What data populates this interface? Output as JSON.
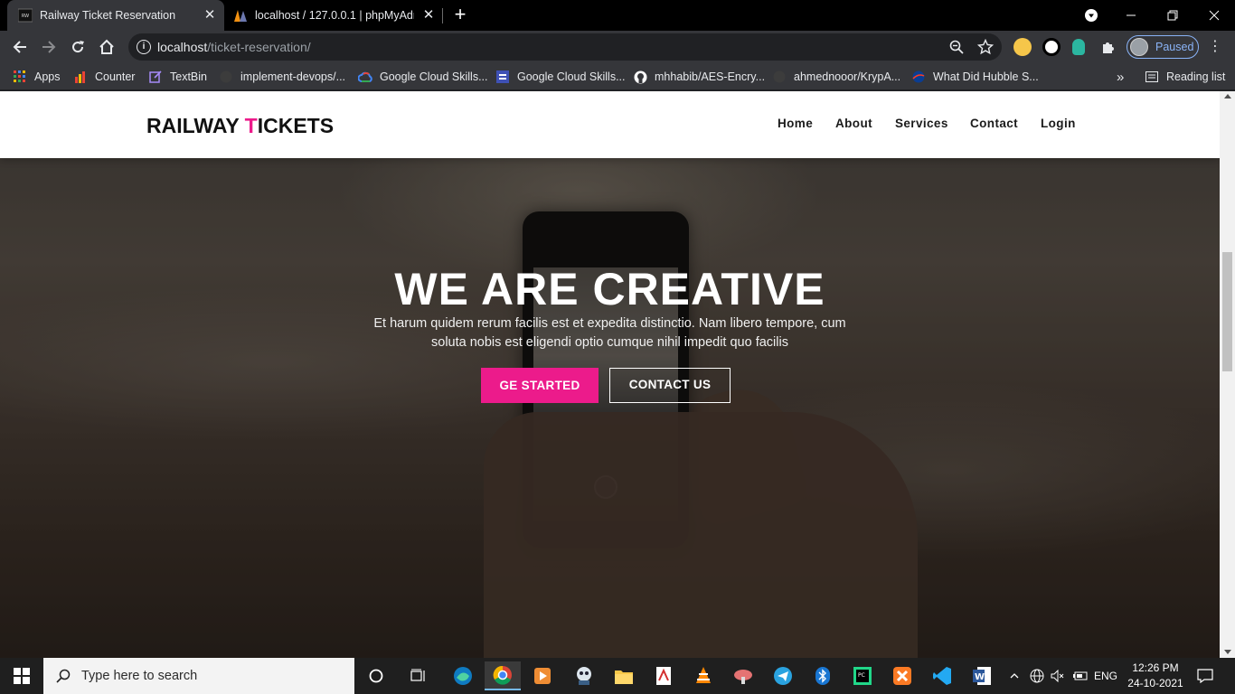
{
  "browser": {
    "tabs": [
      {
        "title": "Railway Ticket Reservation",
        "active": true
      },
      {
        "title": "localhost / 127.0.0.1 | phpMyAdm",
        "active": false
      }
    ],
    "url_host": "localhost",
    "url_path": "/ticket-reservation/",
    "profile_label": "Paused",
    "bookmarks": [
      "Apps",
      "Counter",
      "TextBin",
      "implement-devops/...",
      "Google Cloud Skills...",
      "Google Cloud Skills...",
      "mhhabib/AES-Encry...",
      "ahmednooor/KrypA...",
      "What Did Hubble S..."
    ],
    "bookmarks_overflow": "»",
    "reading_list": "Reading list"
  },
  "site": {
    "logo_part1": "RAILWAY ",
    "logo_accent": "T",
    "logo_part2": "ICKETS",
    "nav": [
      "Home",
      "About",
      "Services",
      "Contact",
      "Login"
    ],
    "hero_title": "WE ARE CREATIVE",
    "hero_subtitle": "Et harum quidem rerum facilis est et expedita distinctio. Nam libero tempore, cum soluta nobis est eligendi optio cumque nihil impedit quo facilis",
    "btn_primary": "GE STARTED",
    "btn_secondary": "CONTACT US",
    "accent_color": "#ec1b8b"
  },
  "taskbar": {
    "search_placeholder": "Type here to search",
    "language": "ENG",
    "time": "12:26 PM",
    "date": "24-10-2021"
  }
}
